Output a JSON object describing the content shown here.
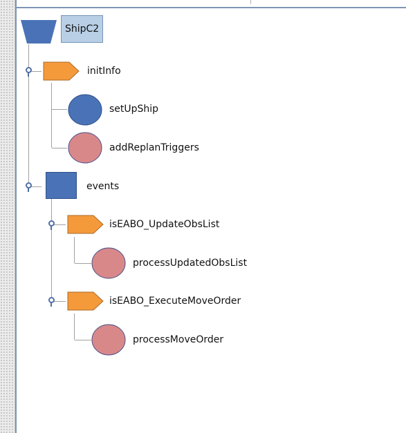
{
  "tree": {
    "root": {
      "label": "ShipC2",
      "icon": "trapezoid-icon",
      "selected": true
    },
    "nodes": {
      "initInfo": {
        "label": "initInfo",
        "icon": "pentagon-tag-icon"
      },
      "setUpShip": {
        "label": "setUpShip",
        "icon": "blue-circle-icon"
      },
      "addReplanTriggers": {
        "label": "addReplanTriggers",
        "icon": "pink-circle-icon"
      },
      "events": {
        "label": "events",
        "icon": "blue-square-icon"
      },
      "updateObsList": {
        "label": "isEABO_UpdateObsList",
        "icon": "pentagon-tag-icon"
      },
      "processUpdatedObsList": {
        "label": "processUpdatedObsList",
        "icon": "pink-circle-icon"
      },
      "executeMoveOrder": {
        "label": "isEABO_ExecuteMoveOrder",
        "icon": "pentagon-tag-icon"
      },
      "processMoveOrder": {
        "label": "processMoveOrder",
        "icon": "pink-circle-icon"
      }
    }
  },
  "colors": {
    "blue": "#4a73b7",
    "orange": "#f59a3b",
    "pink": "#d9888a",
    "selection": "#b8cfe5"
  }
}
